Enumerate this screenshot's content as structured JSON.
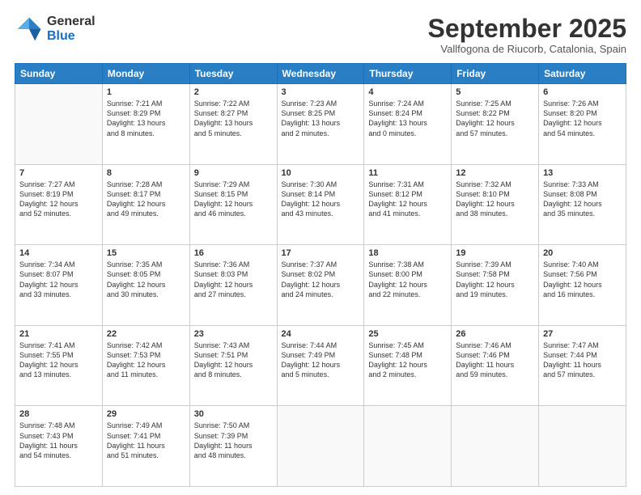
{
  "logo": {
    "general": "General",
    "blue": "Blue"
  },
  "title": "September 2025",
  "location": "Vallfogona de Riucorb, Catalonia, Spain",
  "days_header": [
    "Sunday",
    "Monday",
    "Tuesday",
    "Wednesday",
    "Thursday",
    "Friday",
    "Saturday"
  ],
  "weeks": [
    [
      {
        "day": "",
        "content": ""
      },
      {
        "day": "1",
        "content": "Sunrise: 7:21 AM\nSunset: 8:29 PM\nDaylight: 13 hours\nand 8 minutes."
      },
      {
        "day": "2",
        "content": "Sunrise: 7:22 AM\nSunset: 8:27 PM\nDaylight: 13 hours\nand 5 minutes."
      },
      {
        "day": "3",
        "content": "Sunrise: 7:23 AM\nSunset: 8:25 PM\nDaylight: 13 hours\nand 2 minutes."
      },
      {
        "day": "4",
        "content": "Sunrise: 7:24 AM\nSunset: 8:24 PM\nDaylight: 13 hours\nand 0 minutes."
      },
      {
        "day": "5",
        "content": "Sunrise: 7:25 AM\nSunset: 8:22 PM\nDaylight: 12 hours\nand 57 minutes."
      },
      {
        "day": "6",
        "content": "Sunrise: 7:26 AM\nSunset: 8:20 PM\nDaylight: 12 hours\nand 54 minutes."
      }
    ],
    [
      {
        "day": "7",
        "content": "Sunrise: 7:27 AM\nSunset: 8:19 PM\nDaylight: 12 hours\nand 52 minutes."
      },
      {
        "day": "8",
        "content": "Sunrise: 7:28 AM\nSunset: 8:17 PM\nDaylight: 12 hours\nand 49 minutes."
      },
      {
        "day": "9",
        "content": "Sunrise: 7:29 AM\nSunset: 8:15 PM\nDaylight: 12 hours\nand 46 minutes."
      },
      {
        "day": "10",
        "content": "Sunrise: 7:30 AM\nSunset: 8:14 PM\nDaylight: 12 hours\nand 43 minutes."
      },
      {
        "day": "11",
        "content": "Sunrise: 7:31 AM\nSunset: 8:12 PM\nDaylight: 12 hours\nand 41 minutes."
      },
      {
        "day": "12",
        "content": "Sunrise: 7:32 AM\nSunset: 8:10 PM\nDaylight: 12 hours\nand 38 minutes."
      },
      {
        "day": "13",
        "content": "Sunrise: 7:33 AM\nSunset: 8:08 PM\nDaylight: 12 hours\nand 35 minutes."
      }
    ],
    [
      {
        "day": "14",
        "content": "Sunrise: 7:34 AM\nSunset: 8:07 PM\nDaylight: 12 hours\nand 33 minutes."
      },
      {
        "day": "15",
        "content": "Sunrise: 7:35 AM\nSunset: 8:05 PM\nDaylight: 12 hours\nand 30 minutes."
      },
      {
        "day": "16",
        "content": "Sunrise: 7:36 AM\nSunset: 8:03 PM\nDaylight: 12 hours\nand 27 minutes."
      },
      {
        "day": "17",
        "content": "Sunrise: 7:37 AM\nSunset: 8:02 PM\nDaylight: 12 hours\nand 24 minutes."
      },
      {
        "day": "18",
        "content": "Sunrise: 7:38 AM\nSunset: 8:00 PM\nDaylight: 12 hours\nand 22 minutes."
      },
      {
        "day": "19",
        "content": "Sunrise: 7:39 AM\nSunset: 7:58 PM\nDaylight: 12 hours\nand 19 minutes."
      },
      {
        "day": "20",
        "content": "Sunrise: 7:40 AM\nSunset: 7:56 PM\nDaylight: 12 hours\nand 16 minutes."
      }
    ],
    [
      {
        "day": "21",
        "content": "Sunrise: 7:41 AM\nSunset: 7:55 PM\nDaylight: 12 hours\nand 13 minutes."
      },
      {
        "day": "22",
        "content": "Sunrise: 7:42 AM\nSunset: 7:53 PM\nDaylight: 12 hours\nand 11 minutes."
      },
      {
        "day": "23",
        "content": "Sunrise: 7:43 AM\nSunset: 7:51 PM\nDaylight: 12 hours\nand 8 minutes."
      },
      {
        "day": "24",
        "content": "Sunrise: 7:44 AM\nSunset: 7:49 PM\nDaylight: 12 hours\nand 5 minutes."
      },
      {
        "day": "25",
        "content": "Sunrise: 7:45 AM\nSunset: 7:48 PM\nDaylight: 12 hours\nand 2 minutes."
      },
      {
        "day": "26",
        "content": "Sunrise: 7:46 AM\nSunset: 7:46 PM\nDaylight: 11 hours\nand 59 minutes."
      },
      {
        "day": "27",
        "content": "Sunrise: 7:47 AM\nSunset: 7:44 PM\nDaylight: 11 hours\nand 57 minutes."
      }
    ],
    [
      {
        "day": "28",
        "content": "Sunrise: 7:48 AM\nSunset: 7:43 PM\nDaylight: 11 hours\nand 54 minutes."
      },
      {
        "day": "29",
        "content": "Sunrise: 7:49 AM\nSunset: 7:41 PM\nDaylight: 11 hours\nand 51 minutes."
      },
      {
        "day": "30",
        "content": "Sunrise: 7:50 AM\nSunset: 7:39 PM\nDaylight: 11 hours\nand 48 minutes."
      },
      {
        "day": "",
        "content": ""
      },
      {
        "day": "",
        "content": ""
      },
      {
        "day": "",
        "content": ""
      },
      {
        "day": "",
        "content": ""
      }
    ]
  ]
}
